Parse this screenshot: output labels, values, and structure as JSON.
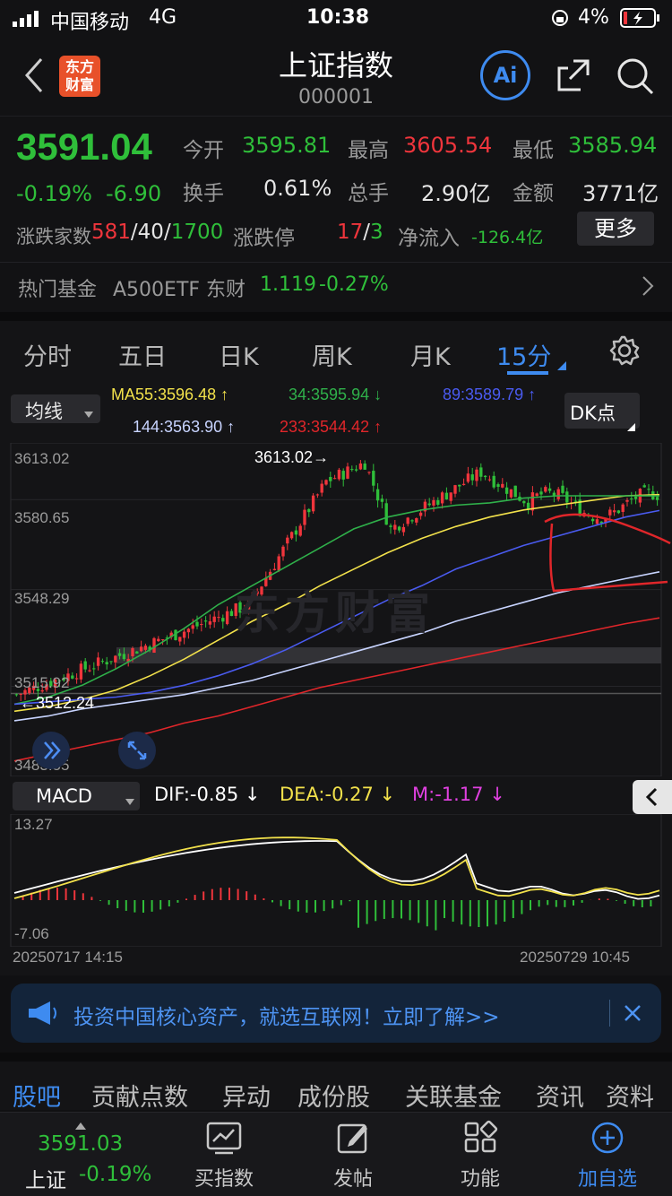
{
  "status": {
    "carrier": "中国移动",
    "network": "4G",
    "time": "10:38",
    "battery": "4%"
  },
  "header": {
    "logo": "东方\n财富",
    "logo_line1": "东方",
    "logo_line2": "财富",
    "title": "上证指数",
    "code": "000001",
    "ai_label": "Ai"
  },
  "quote": {
    "price": "3591.04",
    "change_pct": "-0.19%",
    "change": "-6.90",
    "open_label": "今开",
    "open": "3595.81",
    "high_label": "最高",
    "high": "3605.54",
    "low_label": "最低",
    "low": "3585.94",
    "turnover_label": "换手",
    "turnover": "0.61%",
    "volume_label": "总手",
    "volume": "2.90亿",
    "amount_label": "金额",
    "amount": "3771亿",
    "breadth_label": "涨跌家数",
    "up_count": "581",
    "flat_count": "40",
    "down_count": "1700",
    "sep": "/",
    "limit_label": "涨跌停",
    "limit_up": "17",
    "limit_down": "3",
    "netflow_label": "净流入",
    "netflow": "-126.4亿",
    "more_label": "更多",
    "fund_label": "热门基金",
    "fund_name": "A500ETF 东财",
    "fund_price": "1.119",
    "fund_change": "-0.27%"
  },
  "tabs": [
    "分时",
    "五日",
    "日K",
    "周K",
    "月K",
    "15分"
  ],
  "active_tab": "15分",
  "chart": {
    "ma_select": "均线",
    "ma55": "MA55:3596.48 ↑",
    "ma34": "34:3595.94 ↓",
    "ma89": "89:3589.79 ↑",
    "ma144": "144:3563.90 ↑",
    "ma233": "233:3544.42 ↑",
    "dk_label": "DK点",
    "y_labels": [
      "3613.02",
      "3580.65",
      "3548.29",
      "3515.92",
      "3483.55"
    ],
    "max_marker": "3613.02",
    "min_marker": "3512.24",
    "watermark": "东方财富",
    "macd_select": "MACD",
    "dif": "DIF:-0.85 ↓",
    "dea": "DEA:-0.27 ↓",
    "m": "M:-1.17 ↓",
    "macd_top": "13.27",
    "macd_bottom": "-7.06",
    "date_start": "20250717 14:15",
    "date_end": "20250729 10:45",
    "colors": {
      "ma55": "#f2e14b",
      "ma34": "#2fb04a",
      "ma89": "#4a5bf0",
      "ma144": "#c8d4ff",
      "ma233": "#e0262a",
      "up": "#f0353c",
      "down": "#2fbf3a"
    }
  },
  "chart_data": {
    "type": "line",
    "title": "",
    "x_start": "20250717 14:15",
    "x_end": "20250729 10:45",
    "ylim": [
      3483.55,
      3613.02
    ],
    "series": [
      {
        "name": "MA55",
        "values": [
          3505,
          3507,
          3510,
          3514,
          3520,
          3527,
          3535,
          3543,
          3550,
          3558,
          3565,
          3572,
          3578,
          3583,
          3587,
          3590,
          3592,
          3594,
          3596,
          3596.48
        ]
      },
      {
        "name": "34",
        "values": [
          3508,
          3511,
          3516,
          3523,
          3531,
          3540,
          3550,
          3558,
          3566,
          3574,
          3582,
          3587,
          3590,
          3592,
          3593,
          3595,
          3596,
          3596,
          3596,
          3595.94
        ]
      },
      {
        "name": "89",
        "values": [
          3508,
          3509,
          3510,
          3511,
          3513,
          3516,
          3520,
          3525,
          3531,
          3538,
          3545,
          3552,
          3558,
          3565,
          3570,
          3575,
          3579,
          3583,
          3587,
          3589.79
        ]
      },
      {
        "name": "144",
        "values": [
          3501,
          3503,
          3506,
          3508,
          3510,
          3512,
          3515,
          3518,
          3522,
          3526,
          3530,
          3534,
          3538,
          3543,
          3547,
          3551,
          3555,
          3558,
          3561,
          3563.9
        ]
      },
      {
        "name": "233",
        "values": [
          3484,
          3487,
          3490,
          3493,
          3496,
          3500,
          3503,
          3507,
          3511,
          3515,
          3518,
          3521,
          3524,
          3527,
          3530,
          3533,
          3536,
          3539,
          3542,
          3544.42
        ]
      }
    ]
  },
  "banner": {
    "text": "投资中国核心资产，就选互联网！立即了解>>"
  },
  "subnav": [
    "股吧",
    "贡献点数",
    "异动",
    "成份股",
    "关联基金",
    "资讯",
    "资料"
  ],
  "bottom": {
    "mini_price": "3591.03",
    "mini_name": "上证",
    "mini_change": "-0.19%",
    "items": [
      "买指数",
      "发帖",
      "功能",
      "加自选"
    ]
  }
}
